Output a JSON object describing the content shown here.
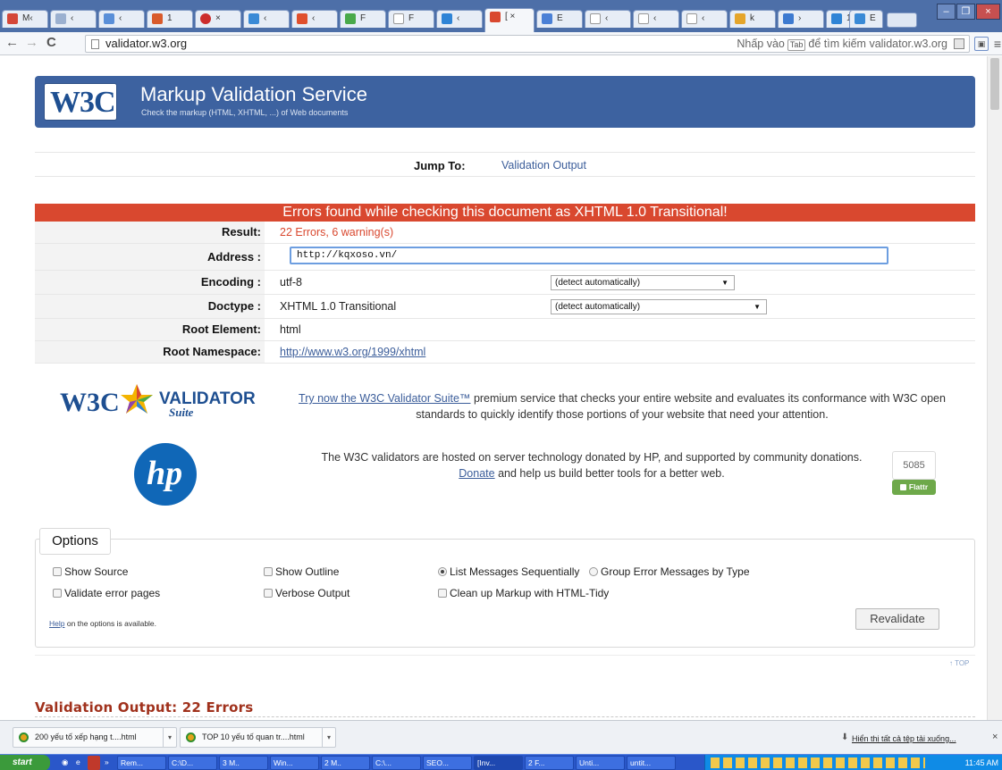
{
  "browser": {
    "tabs": [
      {
        "label": "M‹",
        "fav": "#d44638"
      },
      {
        "label": "‹",
        "fav": "#9bb0d0"
      },
      {
        "label": "‹",
        "fav": "#5a8fd8"
      },
      {
        "label": "1",
        "fav": "#d95b2c"
      },
      {
        "label": "×",
        "fav": "#cc2c2c"
      },
      {
        "label": "‹",
        "fav": "#3a8ad6"
      },
      {
        "label": "‹",
        "fav": "#e0502d"
      },
      {
        "label": "F",
        "fav": "#4aa94a"
      },
      {
        "label": "F",
        "fav": "#ffffff"
      },
      {
        "label": "‹",
        "fav": "#2f84d6"
      },
      {
        "label": "[ ×",
        "fav": "#d9482f"
      },
      {
        "label": "E",
        "fav": "#4b80d6"
      },
      {
        "label": "‹",
        "fav": "#ffffff"
      },
      {
        "label": "‹",
        "fav": "#ffffff"
      },
      {
        "label": "‹",
        "fav": "#ffffff"
      },
      {
        "label": "k",
        "fav": "#e5a52b"
      },
      {
        "label": "›",
        "fav": "#3d7ad0"
      },
      {
        "label": "1",
        "fav": "#2f84d6"
      },
      {
        "label": "E",
        "fav": "#3a8ad6"
      }
    ],
    "url": "validator.w3.org",
    "omnibox_hint_before": "Nhấp vào",
    "omnibox_hint_key": "Tab",
    "omnibox_hint_after": "để tìm kiếm validator.w3.org"
  },
  "page": {
    "logo": "W3C",
    "title": "Markup Validation Service",
    "subtitle": "Check the markup (HTML, XHTML, ...) of Web documents",
    "jump_label": "Jump To:",
    "jump_link": "Validation Output",
    "error_heading": "Errors found while checking this document as XHTML 1.0 Transitional!",
    "result_rows": {
      "result_label": "Result:",
      "result_value": "22 Errors, 6 warning(s)",
      "address_label": "Address :",
      "address_value": "http://kqxoso.vn/",
      "encoding_label": "Encoding :",
      "encoding_value": "utf-8",
      "encoding_select": "(detect automatically)",
      "doctype_label": "Doctype :",
      "doctype_value": "XHTML 1.0 Transitional",
      "doctype_select": "(detect automatically)",
      "root_label": "Root Element:",
      "root_value": "html",
      "ns_label": "Root Namespace:",
      "ns_value": "http://www.w3.org/1999/xhtml"
    },
    "suite_logo_a": "W3C",
    "suite_logo_b": "VALIDATOR",
    "suite_logo_c": "Suite",
    "suite_link": "Try now the W3C Validator Suite™",
    "suite_text": " premium service that checks your entire website and evaluates its conformance with W3C open standards to quickly identify those portions of your website that need your attention.",
    "hp_logo": "hp",
    "hp_text_1": "The W3C validators are hosted on server technology donated by HP, and supported by community donations.",
    "donate_link": "Donate",
    "hp_text_2": " and help us build better tools for a better web.",
    "flattr_count": "5085",
    "flattr_label": "Flattr",
    "options": {
      "legend": "Options",
      "show_source": "Show Source",
      "show_outline": "Show Outline",
      "list_seq": "List Messages Sequentially",
      "group_err": "Group Error Messages by Type",
      "validate_err": "Validate error pages",
      "verbose": "Verbose Output",
      "cleanup": "Clean up Markup with HTML-Tidy",
      "help_link": "Help",
      "help_text": " on the options is available.",
      "revalidate": "Revalidate"
    },
    "top_link": "↑ TOP",
    "output_title": "Validation Output: 22 Errors"
  },
  "downloads": {
    "items": [
      "200 yếu tố xếp hạng t....html",
      "TOP 10 yếu tố quan tr....html"
    ],
    "show_all": "Hiển thị tất cả tệp tải xuống...",
    "close": "×"
  },
  "taskbar": {
    "start": "start",
    "items": [
      "»",
      "Rem...",
      "C:\\D...",
      "3 M..",
      "Win...",
      "2 M..",
      "C:\\...",
      "SEO...",
      "[Inv...",
      "2 F...",
      "Unti...",
      "untit..."
    ],
    "clock": "11:45 AM"
  }
}
